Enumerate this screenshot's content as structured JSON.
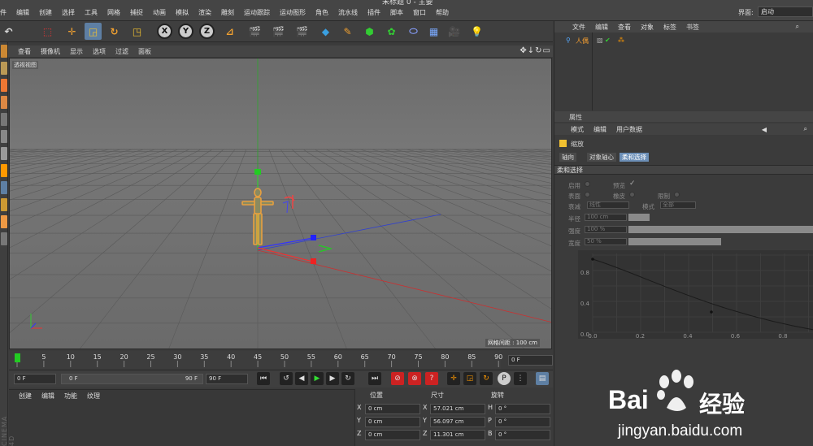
{
  "app": {
    "title_text": "未标题 0 - 主要",
    "menus": [
      "件",
      "编辑",
      "创建",
      "选择",
      "工具",
      "网格",
      "捕捉",
      "动画",
      "模拟",
      "渲染",
      "雕刻",
      "运动跟踪",
      "运动图形",
      "角色",
      "流水线",
      "插件",
      "脚本",
      "窗口",
      "帮助"
    ],
    "interface_label": "界面:",
    "interface_value": "启动"
  },
  "toolbar": {
    "icons": [
      "undo-icon",
      "live-select-icon",
      "move-icon",
      "scale-icon",
      "rotate-icon",
      "scale-object-icon",
      "x-axis-lock",
      "y-axis-lock",
      "z-axis-lock",
      "world-coord-icon",
      "render-view-icon",
      "render-picture-viewer-icon",
      "render-settings-icon",
      "cube-icon",
      "pen-spline-icon",
      "subdivision-icon",
      "cloner-icon",
      "deformer-icon",
      "floor-icon",
      "camera-icon",
      "light-icon"
    ],
    "axis_labels": [
      "X",
      "Y",
      "Z"
    ]
  },
  "viewport": {
    "menus": [
      "查看",
      "摄像机",
      "显示",
      "选项",
      "过滤",
      "面板"
    ],
    "label": "透视视图",
    "grid_info": "网格间距 : 100 cm"
  },
  "timeline": {
    "ticks": [
      "0",
      "5",
      "10",
      "15",
      "20",
      "25",
      "30",
      "35",
      "40",
      "45",
      "50",
      "55",
      "60",
      "65",
      "70",
      "75",
      "80",
      "85",
      "90"
    ],
    "current_frame": "0 F",
    "start_frame": "0 F",
    "range_start": "0 F",
    "range_end": "90 F",
    "end_frame": "90 F"
  },
  "material_panel": {
    "menus": [
      "创建",
      "编辑",
      "功能",
      "纹理"
    ],
    "side_label": "CINEMA 4D"
  },
  "coords": {
    "headers": [
      "位置",
      "尺寸",
      "旋转"
    ],
    "rows": [
      {
        "axis": "X",
        "pos": "0 cm",
        "size_axis": "X",
        "size": "57.021 cm",
        "rot_axis": "H",
        "rot": "0 °"
      },
      {
        "axis": "Y",
        "pos": "0 cm",
        "size_axis": "Y",
        "size": "56.097 cm",
        "rot_axis": "P",
        "rot": "0 °"
      },
      {
        "axis": "Z",
        "pos": "0 cm",
        "size_axis": "Z",
        "size": "11.301 cm",
        "rot_axis": "B",
        "rot": "0 °"
      }
    ]
  },
  "object_manager": {
    "menus": [
      "文件",
      "编辑",
      "查看",
      "对象",
      "标签",
      "书签"
    ],
    "object_name": "人偶"
  },
  "attributes": {
    "title": "属性",
    "menus": [
      "模式",
      "编辑",
      "用户数据"
    ],
    "object_label": "缩放",
    "tabs": [
      "轴向",
      "对象轴心",
      "柔和选择"
    ],
    "active_tab": "柔和选择",
    "section": "柔和选择",
    "enable_label": "启用",
    "preview_label": "预览",
    "surface_label": "表面",
    "rubber_label": "橡皮",
    "restrict_label": "限制",
    "falloff_label": "衰减",
    "falloff_value": "线性",
    "mode_label": "模式",
    "mode_value": "全部",
    "radius_label": "半径",
    "radius_value": "100 cm",
    "strength_label": "强度",
    "strength_value": "100 %",
    "width_label": "宽度",
    "width_value": "50 %",
    "strength_fraction": 1.0,
    "width_fraction": 0.5,
    "graph_y_ticks": [
      "0.8",
      "0.4",
      "0.0"
    ],
    "graph_x_ticks": [
      "0.0",
      "0.2",
      "0.4",
      "0.6",
      "0.8"
    ]
  },
  "watermark": {
    "brand_text": "Bai",
    "brand_text2": "经验",
    "url": "jingyan.baidu.com"
  },
  "colors": {
    "accent_blue": "#6c8fb7",
    "axis_x": "#d03030",
    "axis_y": "#30c030",
    "axis_z": "#3050e0",
    "figure_orange": "#e8a040"
  }
}
